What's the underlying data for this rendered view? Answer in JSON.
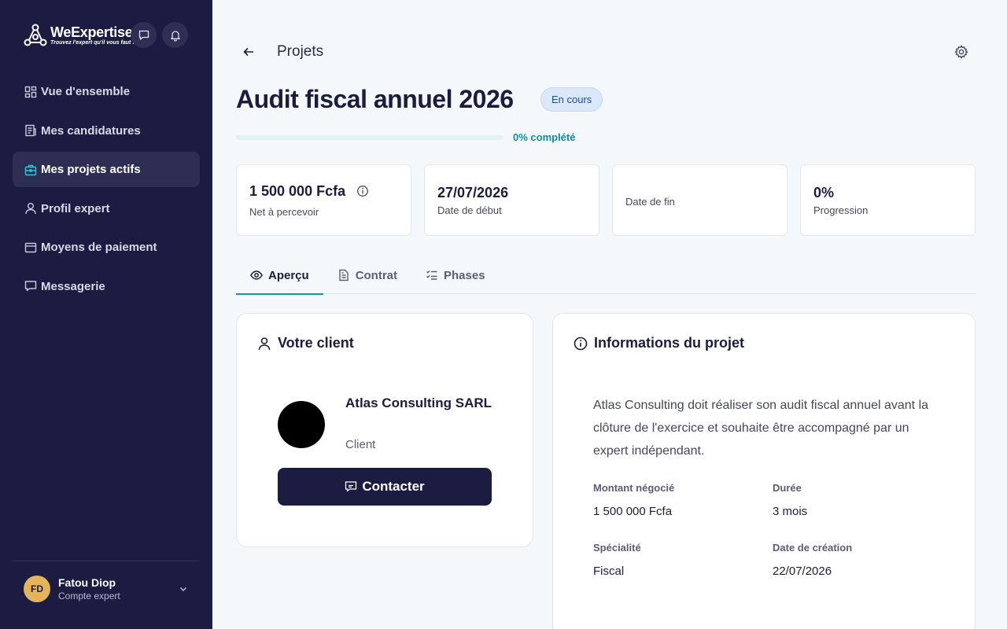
{
  "brand": {
    "name": "WeExpertise",
    "tagline": "Trouvez l'expert qu'il vous faut !"
  },
  "sidebar": {
    "items": [
      {
        "label": "Vue d'ensemble",
        "icon": "dashboard-icon"
      },
      {
        "label": "Mes candidatures",
        "icon": "document-icon"
      },
      {
        "label": "Mes projets actifs",
        "icon": "briefcase-icon",
        "active": true
      },
      {
        "label": "Profil expert",
        "icon": "user-icon"
      },
      {
        "label": "Moyens de paiement",
        "icon": "card-icon"
      },
      {
        "label": "Messagerie",
        "icon": "chat-icon"
      }
    ]
  },
  "user": {
    "initials": "FD",
    "name": "Fatou Diop",
    "role": "Compte expert"
  },
  "header": {
    "breadcrumb": "Projets"
  },
  "project": {
    "title": "Audit fiscal annuel 2026",
    "status": "En cours",
    "progress_fraction": 0,
    "progress_label": "0% complété"
  },
  "stats": [
    {
      "value": "1 500 000 Fcfa",
      "label": "Net à percevoir"
    },
    {
      "value": "27/07/2026",
      "label": "Date de début"
    },
    {
      "value": "",
      "label": "Date de fin"
    },
    {
      "value": "0%",
      "label": "Progression"
    }
  ],
  "tabs": [
    {
      "label": "Aperçu",
      "active": true
    },
    {
      "label": "Contrat"
    },
    {
      "label": "Phases"
    }
  ],
  "client_card": {
    "title": "Votre client",
    "name": "Atlas Consulting SARL",
    "role": "Client",
    "contact_label": "Contacter"
  },
  "info_card": {
    "title": "Informations du projet",
    "description": "Atlas Consulting doit réaliser son audit fiscal annuel avant la clôture de l'exercice et souhaite être accompagné par un expert indépendant.",
    "fields": [
      {
        "label": "Montant négocié",
        "value": "1 500 000 Fcfa"
      },
      {
        "label": "Durée",
        "value": "3 mois"
      },
      {
        "label": "Spécialité",
        "value": "Fiscal"
      },
      {
        "label": "Date de création",
        "value": "22/07/2026"
      }
    ]
  },
  "colors": {
    "sidebar": "#1c1c42",
    "accent": "#0e9ba8",
    "badge_bg": "#dbe8fb"
  }
}
